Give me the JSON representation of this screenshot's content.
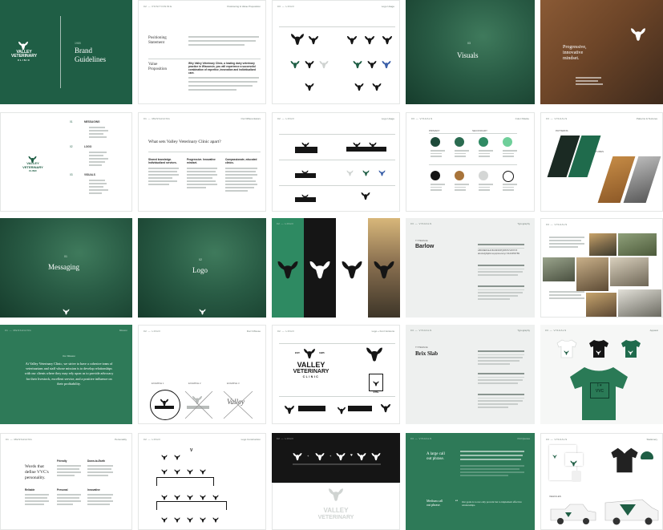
{
  "cover": {
    "year": "1985",
    "title_line1": "Brand",
    "title_line2": "Guidelines",
    "logo_line1": "VALLEY",
    "logo_line2": "VETERINARY",
    "logo_line3": "CLINIC"
  },
  "positioning": {
    "header_left": "02 — POSITIONING",
    "header_right": "Positioning & Value Proposition",
    "label1": "Positioning",
    "label1b": "Statement",
    "label2": "Value",
    "label2b": "Proposition",
    "headline": "Why Valley Veterinary Clinic, a leading dairy veterinary practice in Wisconsin, you will experience a successful combination of expertise, innovation and individualized care."
  },
  "logos_page": {
    "header_left": "03 — LOGO",
    "header_right": "Logo Usage"
  },
  "visuals": {
    "num": "03",
    "title": "Visuals"
  },
  "mindset": {
    "line1": "Progressive,",
    "line2": "innovative",
    "line3": "mindset."
  },
  "toc": {
    "logo_line1": "VALLEY",
    "logo_line2": "VETERINARY",
    "logo_line3": "CLINIC",
    "s1_num": "01",
    "s1": "MESSAGING",
    "s2_num": "02",
    "s2": "LOGO",
    "s3_num": "03",
    "s3": "VISUALS"
  },
  "sets_apart": {
    "header_left": "01 — MESSAGING",
    "header_right": "Our Differentiators",
    "title": "What sets Valley Veterinary Clinic apart?",
    "c1": "Shared knowledge. Individualized services.",
    "c2": "Progressive. Innovative mindset.",
    "c3": "Compassionate, educated clinics."
  },
  "logo_lockups": {
    "header_left": "02 — LOGO",
    "header_right": "Logo Usage"
  },
  "colors": {
    "header_left": "03 — VISUALS",
    "header_right": "Color Palette",
    "primary": "PRIMARY",
    "secondary": "SECONDARY",
    "swatches": [
      {
        "hex": "#1d4a39"
      },
      {
        "hex": "#2a6b50"
      },
      {
        "hex": "#2f8a63"
      },
      {
        "hex": "#6fcf9a"
      },
      {
        "hex": "#151515"
      },
      {
        "hex": "#a8743a"
      },
      {
        "hex": "#d4d6d5"
      },
      {
        "hex": "#ffffff"
      }
    ]
  },
  "patterns": {
    "header_left": "03 — VISUALS",
    "header_right": "Patterns & Textures",
    "label1": "PATTERNS",
    "label2": "TEXTURES"
  },
  "messaging": {
    "num": "01",
    "title": "Messaging"
  },
  "logo_divider": {
    "num": "02",
    "title": "Logo"
  },
  "typeface1": {
    "header_left": "03 — VISUALS",
    "header_right": "Typography",
    "label": "TYPEFACE",
    "name": "Barlow",
    "sample": "ABCDEFGHIJKLMNOPQRSTUVWXYZ abcdefghijklmnopqrstuvwxyz 0123456789"
  },
  "mission": {
    "header_left": "01 — MESSAGING",
    "header_right": "Mission",
    "label": "Our Mission",
    "text": "At Valley Veterinary Clinic, we strive to have a cohesive team of veterinarians and staff whose mission is to develop relationships with our clients where they may rely upon us to provide advocacy for their livestock, excellent service, and a positive influence on their profitability."
  },
  "clearspace": {
    "header_left": "02 — LOGO",
    "header_right": "Don't Misuse",
    "l1": "EXAMPLE 1",
    "l2": "EXAMPLE 2",
    "l3": "EXAMPLE 3"
  },
  "big_logo": {
    "header_left": "02 — LOGO",
    "header_right": "Logo + Font Versions",
    "est": "EST.",
    "year": "1985",
    "line1": "VALLEY",
    "line2": "VETERINARY",
    "line3": "CLINIC",
    "mono": "VVC"
  },
  "typeface2": {
    "header_left": "03 — VISUALS",
    "header_right": "Typography",
    "label": "TYPEFACE",
    "name": "Brix Slab"
  },
  "apparel": {
    "header_left": "03 — VISUALS",
    "header_right": "Apparel",
    "shirt_text1": "I",
    "shirt_text2": "VVC"
  },
  "personality": {
    "header_left": "01 — MESSAGING",
    "header_right": "Personality",
    "title_line1": "Words that",
    "title_line2": "define VVC's",
    "title_line3": "personality.",
    "w1": "Friendly",
    "w2": "Down-to-Earth",
    "w3": "Reliable",
    "w4": "Personal",
    "w5": "Innovative"
  },
  "grid": {
    "header_left": "02 — LOGO",
    "header_right": "Logo Construction",
    "mark": "V"
  },
  "icons": {
    "header_left": "02 — LOGO",
    "line1": "VALLEY",
    "line2": "VETERINARY"
  },
  "callout": {
    "header_left": "03 — VISUALS",
    "header_right": "Pull Quotes",
    "title_line1": "A large call",
    "title_line2": "out phrase.",
    "sub_line1": "Medium call",
    "sub_line2": "out phrase.",
    "quote": "Our goals is to not only prevent but to implement effective relationships."
  },
  "stationery": {
    "header_left": "03 — VISUALS",
    "header_right": "Stationery"
  }
}
